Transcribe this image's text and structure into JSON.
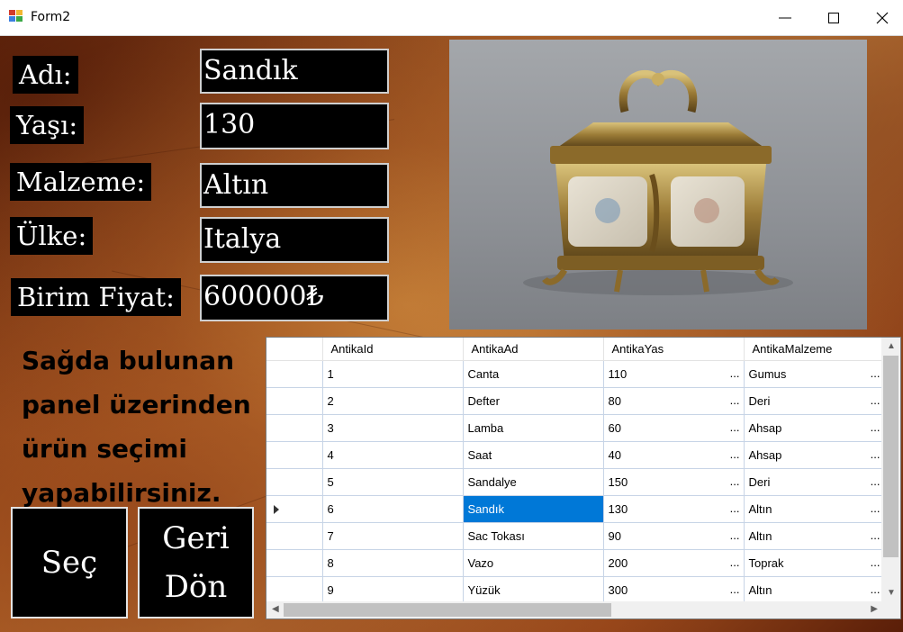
{
  "window": {
    "title": "Form2"
  },
  "form": {
    "fields": [
      {
        "label": "Adı:",
        "value": "Sandık"
      },
      {
        "label": "Yaşı:",
        "value": "130"
      },
      {
        "label": "Malzeme:",
        "value": "Altın"
      },
      {
        "label": "Ülke:",
        "value": "Italya"
      },
      {
        "label": "Birim Fiyat:",
        "value": "600000₺"
      }
    ],
    "hint_lines": [
      "Sağda bulunan",
      "panel üzerinden",
      "ürün seçimi",
      "yapabilirsiniz."
    ],
    "buttons": {
      "select": "Seç",
      "back_line1": "Geri",
      "back_line2": "Dön"
    }
  },
  "grid": {
    "columns": [
      "AntikaId",
      "AntikaAd",
      "AntikaYas",
      "AntikaMalzeme"
    ],
    "rows": [
      [
        "1",
        "Canta",
        "110",
        "Gumus"
      ],
      [
        "2",
        "Defter",
        "80",
        "Deri"
      ],
      [
        "3",
        "Lamba",
        "60",
        "Ahsap"
      ],
      [
        "4",
        "Saat",
        "40",
        "Ahsap"
      ],
      [
        "5",
        "Sandalye",
        "150",
        "Deri"
      ],
      [
        "6",
        "Sandık",
        "130",
        "Altın"
      ],
      [
        "7",
        "Sac Tokası",
        "90",
        "Altın"
      ],
      [
        "8",
        "Vazo",
        "200",
        "Toprak"
      ],
      [
        "9",
        "Yüzük",
        "300",
        "Altın"
      ]
    ],
    "current_row": 6,
    "ellipsis": "..."
  },
  "icons": {
    "app": "form-app-icon",
    "min": "minimize-icon",
    "max": "maximize-icon",
    "close": "close-icon",
    "current_row": "current-row-arrow-icon"
  },
  "colors": {
    "selection": "#0078d7",
    "field_bg": "#000000",
    "field_text": "#ffffff"
  }
}
